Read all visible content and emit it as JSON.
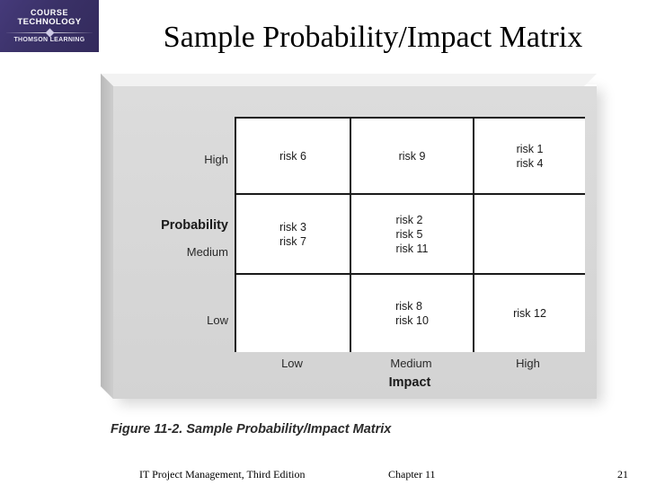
{
  "logo": {
    "line1": "COURSE",
    "line2": "TECHNOLOGY",
    "line3": "THOMSON LEARNING",
    "background_color": "#3b3269"
  },
  "slide": {
    "title": "Sample Probability/Impact Matrix",
    "caption": "Figure 11-2. Sample Probability/Impact Matrix",
    "panel_color": "#d7d7d7"
  },
  "matrix": {
    "y_axis_title": "Probability",
    "x_axis_title": "Impact",
    "y_labels": [
      "High",
      "Medium",
      "Low"
    ],
    "x_labels": [
      "Low",
      "Medium",
      "High"
    ],
    "cells": [
      [
        "risk 6",
        "risk 9",
        "risk 1\nrisk 4"
      ],
      [
        "risk 3\nrisk 7",
        "risk 2\nrisk 5\nrisk 11",
        ""
      ],
      [
        "",
        "risk 8\nrisk 10",
        "risk 12"
      ]
    ]
  },
  "footer": {
    "left": "IT Project Management, Third Edition",
    "center": "Chapter 11",
    "page": "21"
  },
  "chart_data": {
    "type": "table",
    "title": "Sample Probability/Impact Matrix",
    "xlabel": "Impact",
    "ylabel": "Probability",
    "x_categories": [
      "Low",
      "Medium",
      "High"
    ],
    "y_categories": [
      "High",
      "Medium",
      "Low"
    ],
    "grid": true,
    "cells": [
      {
        "probability": "High",
        "impact": "Low",
        "risks": [
          "risk 6"
        ]
      },
      {
        "probability": "High",
        "impact": "Medium",
        "risks": [
          "risk 9"
        ]
      },
      {
        "probability": "High",
        "impact": "High",
        "risks": [
          "risk 1",
          "risk 4"
        ]
      },
      {
        "probability": "Medium",
        "impact": "Low",
        "risks": [
          "risk 3",
          "risk 7"
        ]
      },
      {
        "probability": "Medium",
        "impact": "Medium",
        "risks": [
          "risk 2",
          "risk 5",
          "risk 11"
        ]
      },
      {
        "probability": "Medium",
        "impact": "High",
        "risks": []
      },
      {
        "probability": "Low",
        "impact": "Low",
        "risks": []
      },
      {
        "probability": "Low",
        "impact": "Medium",
        "risks": [
          "risk 8",
          "risk 10"
        ]
      },
      {
        "probability": "Low",
        "impact": "High",
        "risks": [
          "risk 12"
        ]
      }
    ]
  }
}
